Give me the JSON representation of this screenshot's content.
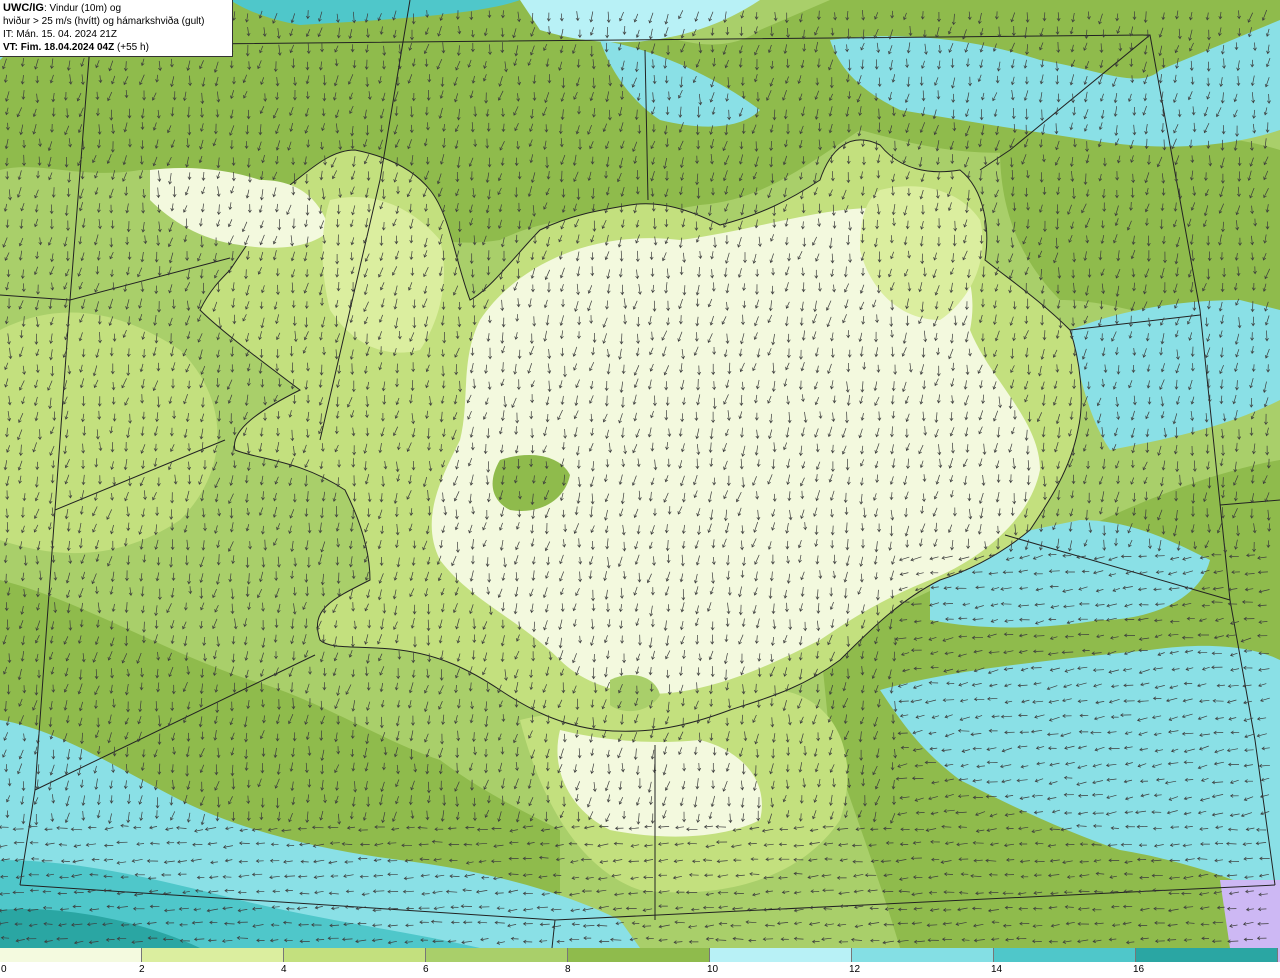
{
  "info_box": {
    "line1_code": "UWC/IG",
    "line1_rest": ": Vindur (10m) og",
    "line2": "hviður > 25 m/s (hvítt) og hámarkshviða (gult)",
    "line3": "IT: Mán. 15. 04. 2024 21Z",
    "line4_bold": "VT: Fim. 18.04.2024 04Z",
    "line4_rest": " (+55 h)"
  },
  "legend": {
    "labels": [
      "0",
      "2",
      "4",
      "6",
      "8",
      "10",
      "12",
      "14",
      "16"
    ],
    "colors": [
      "#f4fadf",
      "#dbee9f",
      "#c3e07e",
      "#a9cf6a",
      "#8fbb4c",
      "#b8f1f6",
      "#84dfe4",
      "#4fc7ca",
      "#2aa6a3",
      "#cdb8f4"
    ]
  },
  "map": {
    "water_color": "#8ae0e6",
    "land_light_color": "#f3f9de",
    "icons": [
      "wind-arrow-icon"
    ]
  }
}
